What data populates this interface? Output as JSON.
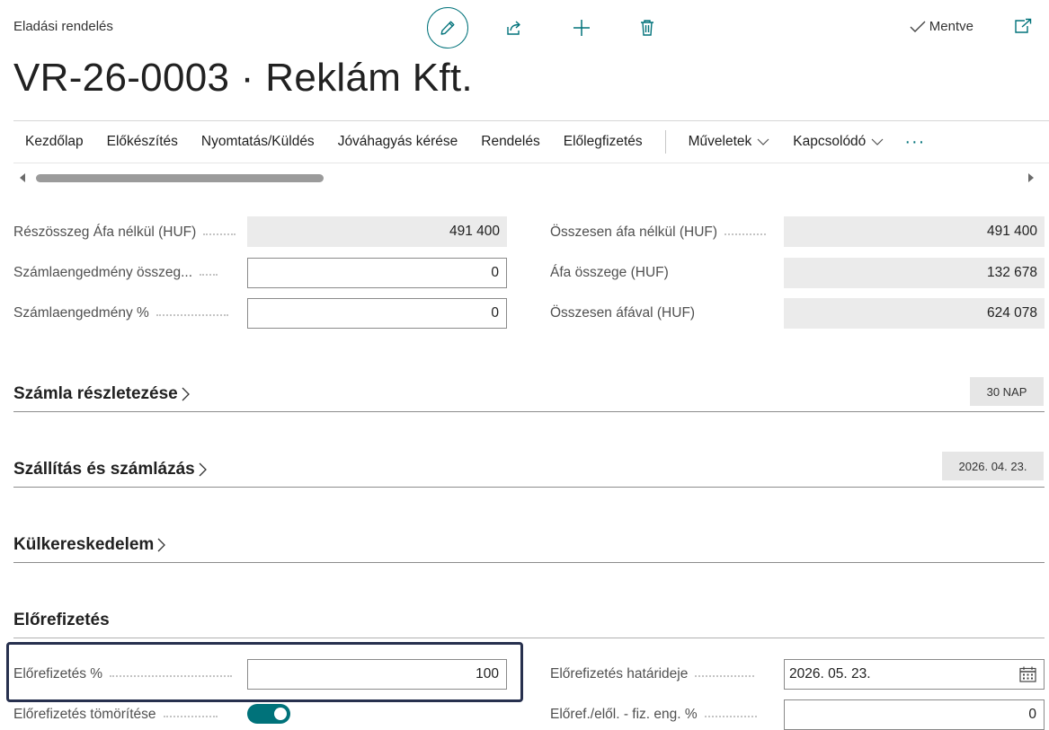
{
  "header": {
    "breadcrumb": "Eladási rendelés",
    "title": "VR-26-0003 · Reklám Kft.",
    "status": "Mentve",
    "icons": [
      "edit-icon",
      "share-icon",
      "plus-icon",
      "delete-icon",
      "check-icon",
      "popout-icon"
    ]
  },
  "actions": {
    "items": [
      "Kezdőlap",
      "Előkészítés",
      "Nyomtatás/Küldés",
      "Jóváhagyás kérése",
      "Rendelés",
      "Előlegfizetés"
    ],
    "menus": [
      "Műveletek",
      "Kapcsolódó"
    ],
    "more": "···"
  },
  "totals": {
    "subtotal_label": "Részösszeg Áfa nélkül (HUF)",
    "subtotal_value": "491 400",
    "inv_discount_amount_label": "Számlaengedmény összeg...",
    "inv_discount_amount_value": "0",
    "inv_discount_pct_label": "Számlaengedmény %",
    "inv_discount_pct_value": "0",
    "total_excl_label": "Összesen áfa nélkül (HUF)",
    "total_excl_value": "491 400",
    "vat_amount_label": "Áfa összege (HUF)",
    "vat_amount_value": "132 678",
    "total_incl_label": "Összesen áfával (HUF)",
    "total_incl_value": "624 078"
  },
  "sections": {
    "invoice_details": {
      "title": "Számla részletezése",
      "badge": "30 NAP"
    },
    "shipping": {
      "title": "Szállítás és számlázás",
      "badge": "2026. 04. 23."
    },
    "foreign_trade": {
      "title": "Külkereskedelem"
    },
    "prepayment": {
      "title": "Előrefizetés"
    }
  },
  "prepayment": {
    "pct_label": "Előrefizetés %",
    "pct_value": "100",
    "compress_label": "Előrefizetés tömörítése",
    "compress_on": true,
    "due_date_label": "Előrefizetés határideje",
    "due_date_value": "2026. 05. 23.",
    "discount_pct_label": "Előref./elől. - fiz. eng. %",
    "discount_pct_value": "0"
  },
  "colors": {
    "accent": "#00727a",
    "highlight_border": "#27304e"
  }
}
